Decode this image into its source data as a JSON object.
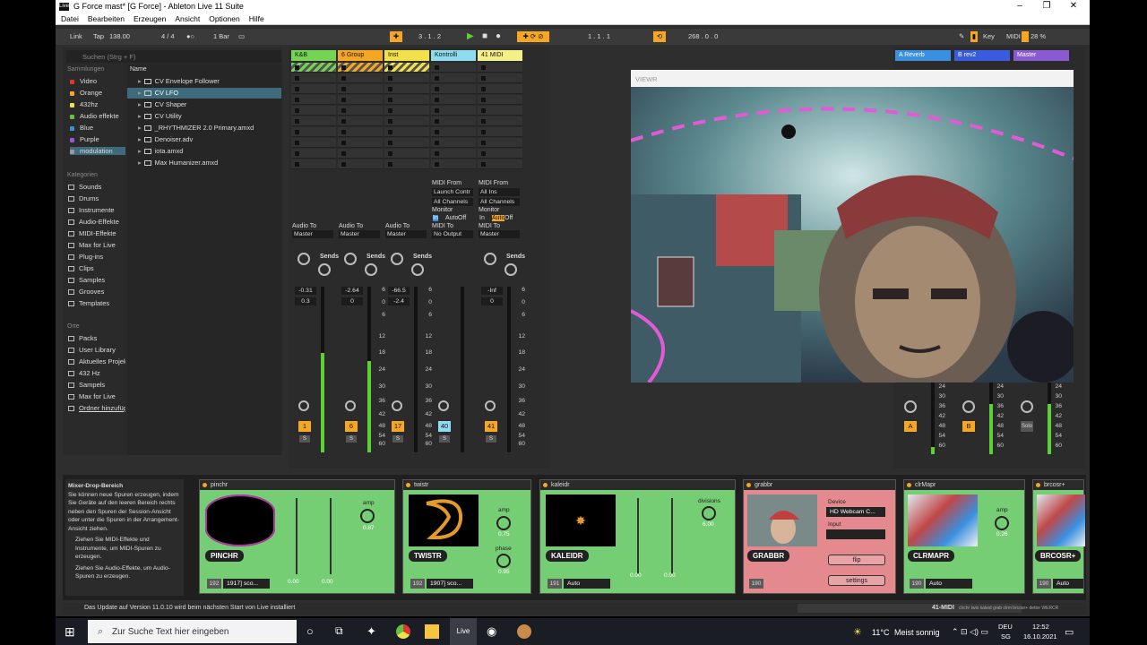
{
  "window": {
    "title": "G Force mast* [G Force] - Ableton Live 11 Suite",
    "app_icon": "Live",
    "controls": [
      "–",
      "❐",
      "✕"
    ]
  },
  "menu": [
    "Datei",
    "Bearbeiten",
    "Erzeugen",
    "Ansicht",
    "Optionen",
    "Hilfe"
  ],
  "transport": {
    "link": "Link",
    "tap": "Tap",
    "tempo": "138.00",
    "signature": "4 / 4",
    "quantize": "1 Bar",
    "position": "3 .   1 .   2",
    "loop_pos": "1 .   1 .   1",
    "loop_len": "268 .   0 .   0",
    "key": "Key",
    "midi": "MIDI",
    "cpu": "28 %"
  },
  "browser": {
    "search_placeholder": "Suchen (Strg + F)",
    "collections_header": "Sammlungen",
    "collections": [
      {
        "label": "Video",
        "color": "#e0362c"
      },
      {
        "label": "Orange",
        "color": "#f5a623"
      },
      {
        "label": "432hz",
        "color": "#f3e14b"
      },
      {
        "label": "Audio effekte",
        "color": "#62c243"
      },
      {
        "label": "Blue",
        "color": "#3a8fe0"
      },
      {
        "label": "Purple",
        "color": "#9b59d0"
      },
      {
        "label": "modulation",
        "color": "#999999"
      }
    ],
    "categories_header": "Kategorien",
    "categories": [
      "Sounds",
      "Drums",
      "Instrumente",
      "Audio-Effekte",
      "MIDI-Effekte",
      "Max for Live",
      "Plug-ins",
      "Clips",
      "Samples",
      "Grooves",
      "Templates"
    ],
    "places_header": "Orte",
    "places": [
      "Packs",
      "User Library",
      "Aktuelles Projekt",
      "432 Hz",
      "Sampels",
      "Max for Live",
      "Ordner hinzufügen..."
    ],
    "name_header": "Name",
    "files": [
      "CV Envelope Follower",
      "CV LFO",
      "CV Shaper",
      "CV Utility",
      "_RHYTHMIZER 2.0 Primary.amxd",
      "Denoiser.adv",
      "iota.amxd",
      "Max Humanizer.amxd"
    ]
  },
  "tracks": [
    {
      "name": "K&B",
      "color": "#76d455",
      "io": "Audio To",
      "dest": "Master",
      "vol": "-0.31",
      "pan": "0.3",
      "num": "1",
      "meter": 0.6
    },
    {
      "name": "6 Group",
      "color": "#f5a623",
      "io": "Audio To",
      "dest": "Master",
      "vol": "-2.64",
      "pan": "0",
      "num": "6",
      "meter": 0.55
    },
    {
      "name": "Inst",
      "color": "#f3e14b",
      "io": "Audio To",
      "dest": "Master",
      "vol": "-66.5",
      "pan": "-2.4",
      "num": "17",
      "meter": 0
    },
    {
      "name": "Kontrolli",
      "color": "#8fdcf0",
      "io": "MIDI To",
      "dest": "No Output",
      "vol": "",
      "pan": "",
      "num": "40",
      "meter": 0,
      "midi_from": "MIDI From",
      "from_src": "Launch Contr",
      "channel": "All Channels",
      "monitor": "Monitor"
    },
    {
      "name": "41 MIDI",
      "color": "#f3f08a",
      "io": "MIDI To",
      "dest": "Master",
      "vol": "-Inf",
      "pan": "0",
      "num": "41",
      "meter": 0,
      "midi_from": "MIDI From",
      "from_src": "All Ins",
      "channel": "All Channels",
      "monitor": "Monitor"
    }
  ],
  "monitor_options": [
    "In",
    "Auto",
    "Off"
  ],
  "sends_label": "Sends",
  "scale": [
    "6",
    "0",
    "6",
    "12",
    "18",
    "24",
    "30",
    "36",
    "42",
    "48",
    "54",
    "60"
  ],
  "returns": [
    {
      "name": "A Reverb",
      "color": "#3a8fe0",
      "letter": "A"
    },
    {
      "name": "B rev2",
      "color": "#3a5be0",
      "letter": "B"
    },
    {
      "name": "Master",
      "color": "#8a5bd0",
      "letter": "Solo"
    }
  ],
  "video_window": {
    "title": "VIEWR"
  },
  "info": {
    "title": "Mixer-Drop-Bereich",
    "text": "Sie können neue Spuren erzeugen, indem Sie Geräte auf den leeren Bereich rechts neben den Spuren der Session-Ansicht oder unter die Spuren in der Arrangement-Ansicht ziehen.",
    "bullet1": "Ziehen Sie MIDI-Effekte und Instrumente, um MIDI-Spuren zu erzeugen.",
    "bullet2": "Ziehen Sie Audio-Effekte, um Audio-Spuren zu erzeugen."
  },
  "devices": [
    {
      "title": "pinchr",
      "name": "PINCHR",
      "num": "192",
      "sel": "1917] sco...",
      "v1": "0.00",
      "v2": "0.00",
      "knob_label": "amp",
      "knob_val": "0.87"
    },
    {
      "title": "twistr",
      "name": "TWISTR",
      "num": "192",
      "sel": "1907] sco...",
      "k1": "amp",
      "k1v": "0.75",
      "k2": "phase",
      "k2v": "0.95"
    },
    {
      "title": "kaleidr",
      "name": "KALEIDR",
      "num": "191",
      "sel": "Auto",
      "v1": "0.00",
      "v2": "0.00",
      "knob_label": "divisions",
      "knob_val": "6.00"
    },
    {
      "title": "grabbr",
      "name": "GRABBR",
      "num": "190",
      "device_label": "Device",
      "device": "HD Webcam C...",
      "input_label": "Input",
      "flip": "flip",
      "settings": "settings"
    },
    {
      "title": "clrMapr",
      "name": "CLRMAPR",
      "num": "190",
      "sel": "Auto",
      "knob_label": "amp",
      "knob_val": "0.26"
    },
    {
      "title": "brcosr+",
      "name": "BRCOSR+",
      "num": "190",
      "sel": "Auto"
    }
  ],
  "status": {
    "message": "Das Update auf Version 11.0.10 wird beim nächsten Start von Live installiert",
    "track": "41-MIDI",
    "chain": "clrchr twis kaleid grab clrm  brcosr+  detior  WERCR"
  },
  "taskbar": {
    "search": "Zur Suche Text hier eingeben",
    "live": "Live",
    "temp": "11°C",
    "weather": "Meist sonnig",
    "lang": "DEU",
    "region": "SG",
    "time": "12:52",
    "date": "16.10.2021"
  }
}
